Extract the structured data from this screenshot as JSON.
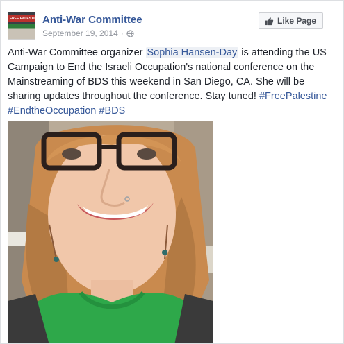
{
  "header": {
    "page_name": "Anti-War Committee",
    "date": "September 19, 2014",
    "separator": "·",
    "avatar_banner_text": "FREE PALESTINE",
    "like_button_label": "Like Page"
  },
  "post": {
    "text_before_mention": "Anti-War Committee organizer ",
    "mention": "Sophia Hansen-Day",
    "text_after_mention": " is attending the US Campaign to End the Israeli Occupation's national conference on the Mainstreaming of BDS this weekend in San Diego, CA. She will be sharing updates throughout the conference. Stay tuned! ",
    "hashtags": [
      "#FreePalestine",
      "#EndtheOccupation",
      "#BDS"
    ]
  },
  "icons": {
    "privacy": "globe-icon",
    "like": "thumbs-up-icon"
  },
  "colors": {
    "link": "#365899",
    "meta": "#90949c",
    "text": "#1d2129",
    "shirt": "#2ea84a"
  }
}
